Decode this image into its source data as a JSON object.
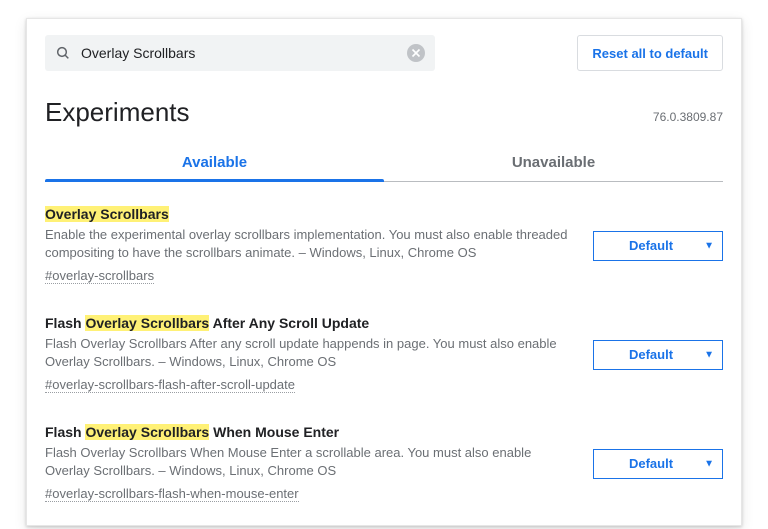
{
  "search": {
    "value": "Overlay Scrollbars"
  },
  "reset_label": "Reset all to default",
  "page_title": "Experiments",
  "version": "76.0.3809.87",
  "tabs": {
    "available": "Available",
    "unavailable": "Unavailable"
  },
  "highlight_term": "Overlay Scrollbars",
  "select_default": "Default",
  "flags": [
    {
      "title": "Overlay Scrollbars",
      "desc": "Enable the experimental overlay scrollbars implementation. You must also enable threaded compositing to have the scrollbars animate. – Windows, Linux, Chrome OS",
      "hash": "#overlay-scrollbars",
      "value": "Default"
    },
    {
      "title": "Flash Overlay Scrollbars After Any Scroll Update",
      "desc": "Flash Overlay Scrollbars After any scroll update happends in page. You must also enable Overlay Scrollbars. – Windows, Linux, Chrome OS",
      "hash": "#overlay-scrollbars-flash-after-scroll-update",
      "value": "Default"
    },
    {
      "title": "Flash Overlay Scrollbars When Mouse Enter",
      "desc": "Flash Overlay Scrollbars When Mouse Enter a scrollable area. You must also enable Overlay Scrollbars. – Windows, Linux, Chrome OS",
      "hash": "#overlay-scrollbars-flash-when-mouse-enter",
      "value": "Default"
    }
  ]
}
